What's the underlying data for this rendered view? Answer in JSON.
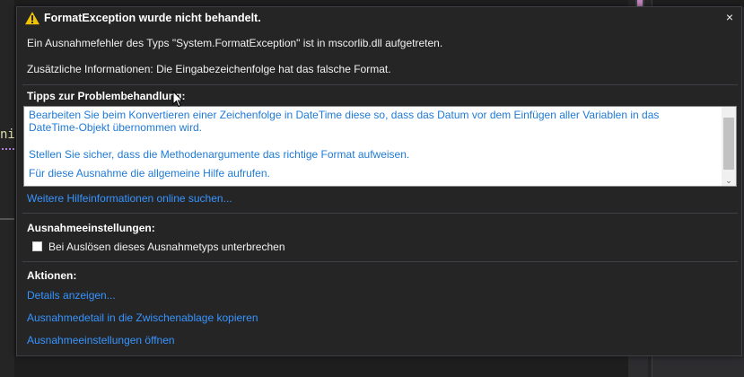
{
  "background": {
    "code_fragment": "ni"
  },
  "popup": {
    "title": "FormatException wurde nicht behandelt.",
    "close_symbol": "×",
    "message": "Ein Ausnahmefehler des Typs \"System.FormatException\" ist in mscorlib.dll aufgetreten.",
    "additional_info": "Zusätzliche Informationen: Die Eingabezeichenfolge hat das falsche Format.",
    "tips": {
      "heading": "Tipps zur Problembehandlung:",
      "items": [
        "Bearbeiten Sie beim Konvertieren einer Zeichenfolge in DateTime diese so, dass das Datum vor dem Einfügen aller Variablen in das DateTime-Objekt übernommen wird.",
        "Stellen Sie sicher, dass die Methodenargumente das richtige Format aufweisen.",
        "Für diese Ausnahme die allgemeine Hilfe aufrufen."
      ]
    },
    "online_help_link": "Weitere Hilfeinformationen online suchen...",
    "exception_settings": {
      "heading": "Ausnahmeeinstellungen:",
      "checkbox_label": "Bei Auslösen dieses Ausnahmetyps unterbrechen",
      "checked": false
    },
    "actions": {
      "heading": "Aktionen:",
      "items": [
        "Details anzeigen...",
        "Ausnahmedetail in die Zwischenablage kopieren",
        "Ausnahmeeinstellungen öffnen"
      ]
    }
  },
  "colors": {
    "popup_bg": "#252526",
    "link": "#3794ff",
    "tip_link": "#1f7ad6",
    "warning": "#f0c300"
  },
  "icons": {
    "warning": "warning-triangle-icon",
    "close": "close-icon",
    "cursor": "mouse-cursor-icon"
  }
}
